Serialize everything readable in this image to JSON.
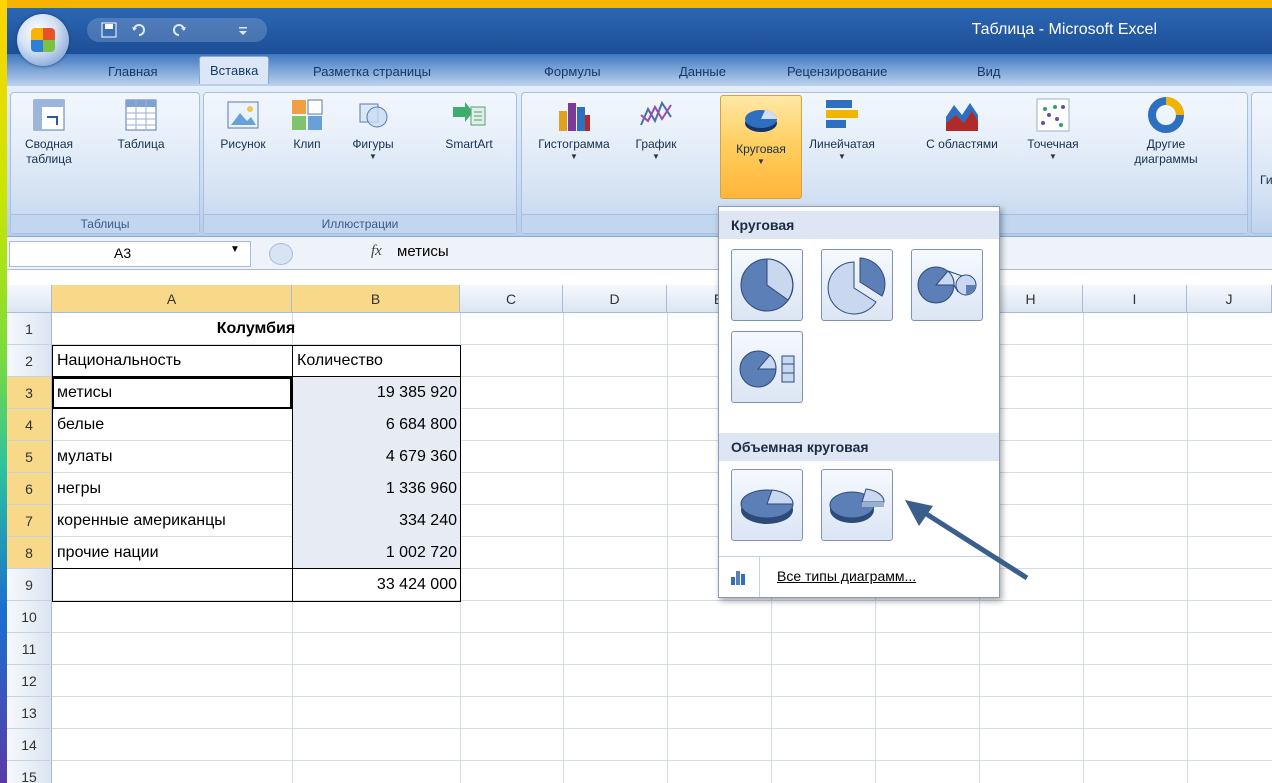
{
  "window": {
    "title": "Таблица - Microsoft Excel"
  },
  "tabs": [
    "Главная",
    "Вставка",
    "Разметка страницы",
    "Формулы",
    "Данные",
    "Рецензирование",
    "Вид"
  ],
  "active_tab": "Вставка",
  "ribbon": {
    "groups": {
      "tables": {
        "label": "Таблицы",
        "buttons": [
          "Сводная таблица",
          "Таблица"
        ]
      },
      "illustrations": {
        "label": "Иллюстрации",
        "buttons": [
          "Рисунок",
          "Клип",
          "Фигуры",
          "SmartArt"
        ]
      },
      "charts": {
        "buttons": [
          "Гистограмма",
          "График",
          "Круговая",
          "Линейчатая",
          "С областями",
          "Точечная",
          "Другие диаграммы"
        ]
      }
    },
    "partial_next": "Ги"
  },
  "formula_bar": {
    "name_box": "A3",
    "fx_label": "fx",
    "content": "метисы"
  },
  "columns": [
    "A",
    "B",
    "C",
    "D",
    "E",
    "F",
    "G",
    "H",
    "I",
    "J"
  ],
  "rows": [
    "1",
    "2",
    "3",
    "4",
    "5",
    "6",
    "7",
    "8",
    "9",
    "10",
    "11",
    "12",
    "13",
    "14",
    "15"
  ],
  "sheet": {
    "title": "Колумбия",
    "header_a": "Национальность",
    "header_b": "Количество",
    "data": [
      {
        "name": "метисы",
        "value": "19 385 920"
      },
      {
        "name": "белые",
        "value": "6 684 800"
      },
      {
        "name": "мулаты",
        "value": "4 679 360"
      },
      {
        "name": "негры",
        "value": "1 336 960"
      },
      {
        "name": "коренные американцы",
        "value": "334 240"
      },
      {
        "name": "прочие нации",
        "value": "1 002 720"
      }
    ],
    "total": "33 424 000"
  },
  "dropdown": {
    "section_pie": "Круговая",
    "section_3d_pie": "Объемная круговая",
    "all_types": "Все типы диаграмм..."
  },
  "colors": {
    "accent_active": "#ffc84a",
    "selection": "#f8d98a",
    "arrow": "#3a5f8c"
  }
}
